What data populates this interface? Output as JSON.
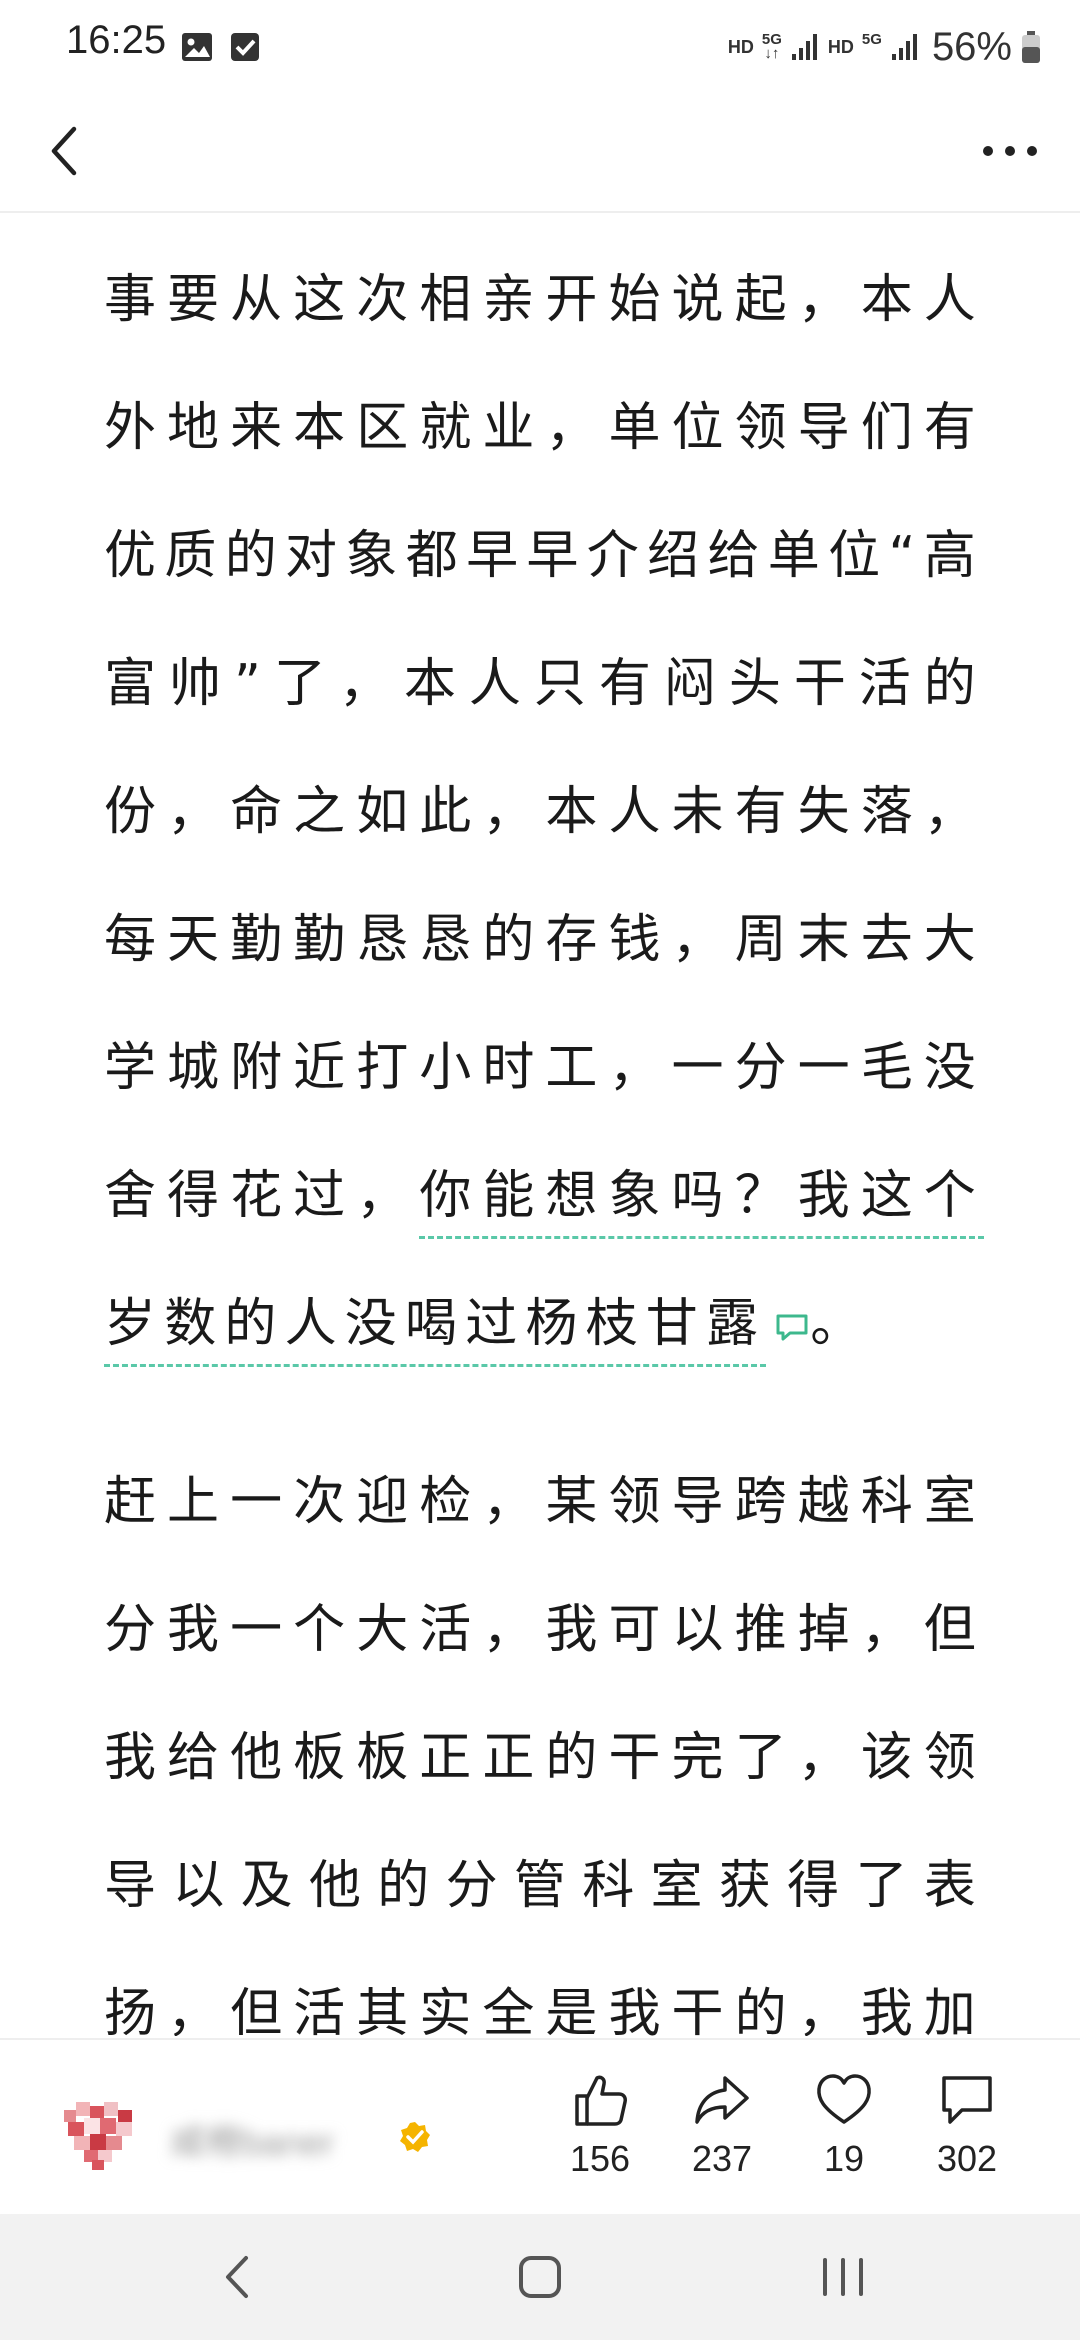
{
  "status_bar": {
    "time": "16:25",
    "left_icons": [
      "image-icon",
      "checkbox-icon"
    ],
    "network": [
      "HD",
      "5G",
      "HD",
      "5G"
    ],
    "battery": "56%"
  },
  "header": {
    "back_icon": "chevron-left-icon",
    "more_icon": "more-horizontal-icon"
  },
  "article": {
    "para1_before": "事要从这次相亲开始说起，本人外地来本区就业，单位领导们有优质的对象都早早介绍给单位“高富帅”了，本人只有闷头干活的份，命之如此，本人未有失落，每天勤勤恳恳的存钱，周末去大学城附近打小时工，一分一毛没舍得花过，",
    "para1_annotated": "你能想象吗？我这个岁数的人没喝过杨枝甘露",
    "para1_after": "。",
    "para2": "赶上一次迎检，某领导跨越科室分我一个大活，我可以推掉，但我给他板板正正的干完了，该领导以及他的分管科室获得了表扬，但活其实全是我干的，我加班加点弄的。",
    "annotation_color": "#5ac8a8"
  },
  "action_bar": {
    "author_name": "咸橙baner",
    "like_count": "156",
    "share_count": "237",
    "favorite_count": "19",
    "comment_count": "302"
  },
  "nav_bar": {
    "icons": [
      "nav-back-icon",
      "nav-home-icon",
      "nav-recents-icon"
    ]
  }
}
